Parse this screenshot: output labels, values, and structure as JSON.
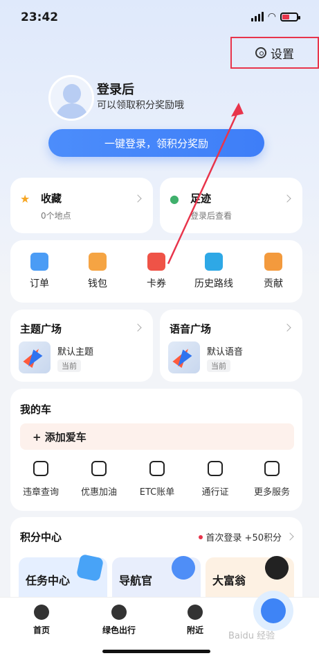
{
  "status": {
    "time": "23:42"
  },
  "header": {
    "settings_label": "设置"
  },
  "login": {
    "title": "登录后",
    "subtitle": "可以领取积分奖励哦",
    "button": "一键登录，领积分奖励"
  },
  "shortcuts": {
    "favorites": {
      "title": "收藏",
      "subtitle": "0个地点"
    },
    "footprint": {
      "title": "足迹",
      "subtitle": "登录后查看"
    }
  },
  "tools": [
    "订单",
    "钱包",
    "卡券",
    "历史路线",
    "贡献"
  ],
  "theme": {
    "title": "主题广场",
    "name": "默认主题",
    "badge": "当前"
  },
  "voice": {
    "title": "语音广场",
    "name": "默认语音",
    "badge": "当前"
  },
  "car": {
    "title": "我的车",
    "add": "+ 添加爱车",
    "services": [
      "违章查询",
      "优惠加油",
      "ETC账单",
      "通行证",
      "更多服务"
    ]
  },
  "points": {
    "title": "积分中心",
    "promo": "首次登录 +50积分",
    "tiles": [
      "任务中心",
      "导航官",
      "大富翁"
    ]
  },
  "tabbar": [
    "首页",
    "绿色出行",
    "附近"
  ],
  "watermark": "Baidu 经验",
  "colors": {
    "accent": "#3e7ef8",
    "highlight": "#e8344b"
  }
}
